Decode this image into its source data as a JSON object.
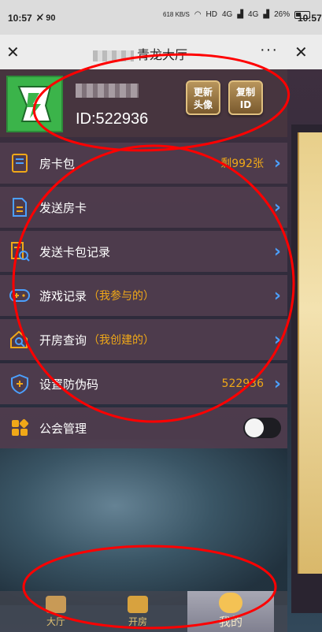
{
  "status_bar": {
    "time": "10:57",
    "time_right": "10:57",
    "left_icons": "90",
    "net_speed": "618 KB/S",
    "hd": "HD",
    "signal1": "4G",
    "signal2": "4G",
    "battery": "26%"
  },
  "title_bar": {
    "title": "青龙大厅",
    "more": "···",
    "close_icon": "close-icon"
  },
  "profile": {
    "user_id": "ID:522936",
    "update_avatar_label_1": "更新",
    "update_avatar_label_2": "头像",
    "copy_id_label_1": "复制",
    "copy_id_label_2": "ID"
  },
  "menu": {
    "items": [
      {
        "label": "房卡包",
        "sub": "",
        "value": "剩992张",
        "icon": "card-pack-icon"
      },
      {
        "label": "发送房卡",
        "sub": "",
        "value": "",
        "icon": "send-card-icon"
      },
      {
        "label": "发送卡包记录",
        "sub": "",
        "value": "",
        "icon": "record-search-icon"
      },
      {
        "label": "游戏记录",
        "sub": "（我参与的）",
        "value": "",
        "icon": "gamepad-icon"
      },
      {
        "label": "开房查询",
        "sub": "（我创建的）",
        "value": "",
        "icon": "house-search-icon"
      },
      {
        "label": "设置防伪码",
        "sub": "",
        "value": "522936",
        "icon": "shield-plus-icon"
      },
      {
        "label": "公会管理",
        "sub": "",
        "value": "",
        "icon": "guild-icon"
      }
    ],
    "guild_toggle_on": false
  },
  "nav": {
    "hall": "大厅",
    "room": "开房",
    "mine": "我的"
  },
  "colors": {
    "accent_orange": "#f0a818",
    "chevron_blue": "#4ba0ff",
    "annotation_red": "#ff0000"
  }
}
